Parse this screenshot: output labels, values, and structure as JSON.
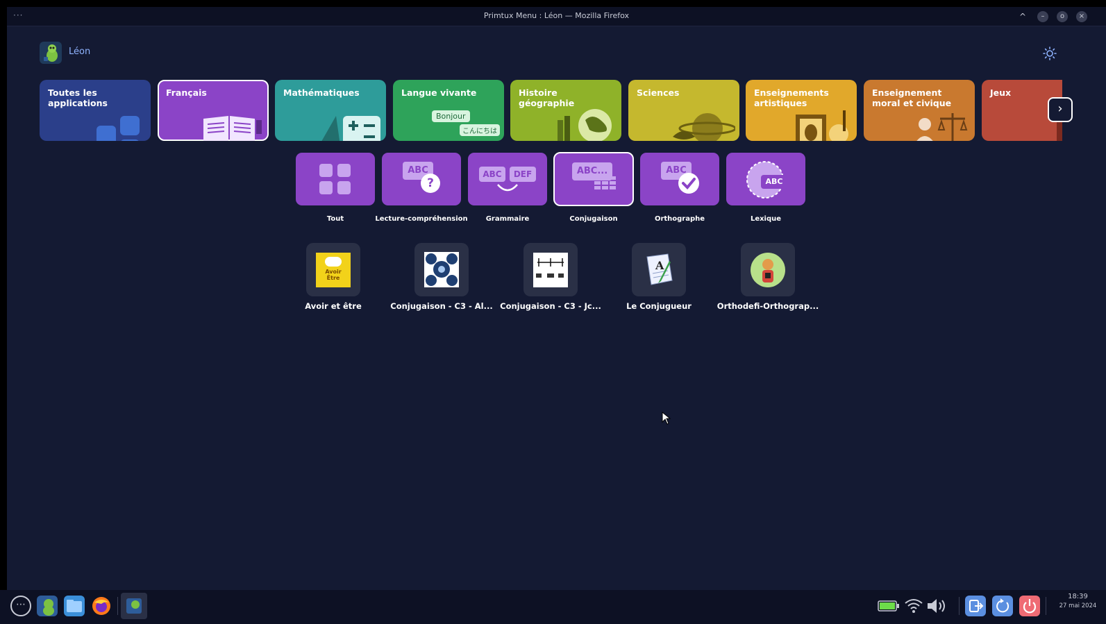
{
  "window": {
    "title": "Primtux Menu : Léon — Mozilla Firefox",
    "menu_dots": "···",
    "buttons": [
      "^",
      "–",
      "o",
      "×"
    ]
  },
  "user": {
    "name": "Léon"
  },
  "categories": [
    {
      "label": "Toutes les applications",
      "color": "#2b3f8a"
    },
    {
      "label": "Français",
      "color": "#8b44c7"
    },
    {
      "label": "Mathématiques",
      "color": "#2e9c9a"
    },
    {
      "label": "Langue vivante",
      "color": "#2ea35a"
    },
    {
      "label": "Histoire géographie",
      "color": "#8fb229"
    },
    {
      "label": "Sciences",
      "color": "#c5b82e"
    },
    {
      "label": "Enseignements artistiques",
      "color": "#e1a82b"
    },
    {
      "label": "Enseignement moral et civique",
      "color": "#c9792f"
    },
    {
      "label": "Jeux",
      "color": "#b84a3a"
    }
  ],
  "deco_text": {
    "bonjour": "Bonjour",
    "konnichiwa": "こんにちは"
  },
  "subcategories": [
    {
      "label": "Tout"
    },
    {
      "label": "Lecture-compréhension",
      "glyph": "ABC"
    },
    {
      "label": "Grammaire",
      "glyph_a": "ABC",
      "glyph_b": "DEF"
    },
    {
      "label": "Conjugaison",
      "glyph": "ABC..."
    },
    {
      "label": "Orthographe",
      "glyph": "ABC"
    },
    {
      "label": "Lexique",
      "glyph": "ABC"
    }
  ],
  "apps": [
    {
      "label": "Avoir et être",
      "icon_text_1": "Avoir",
      "icon_text_2": "Être"
    },
    {
      "label": "Conjugaison - C3 - Al..."
    },
    {
      "label": "Conjugaison - C3 - Jc..."
    },
    {
      "label": "Le Conjugueur"
    },
    {
      "label": "Orthodefi-Orthograp..."
    }
  ],
  "clock": {
    "time": "18:39",
    "date": "27 mai 2024"
  },
  "colors": {
    "background": "#141a33",
    "subcategory": "#8b44c7",
    "accent": "#8fb3ff"
  }
}
